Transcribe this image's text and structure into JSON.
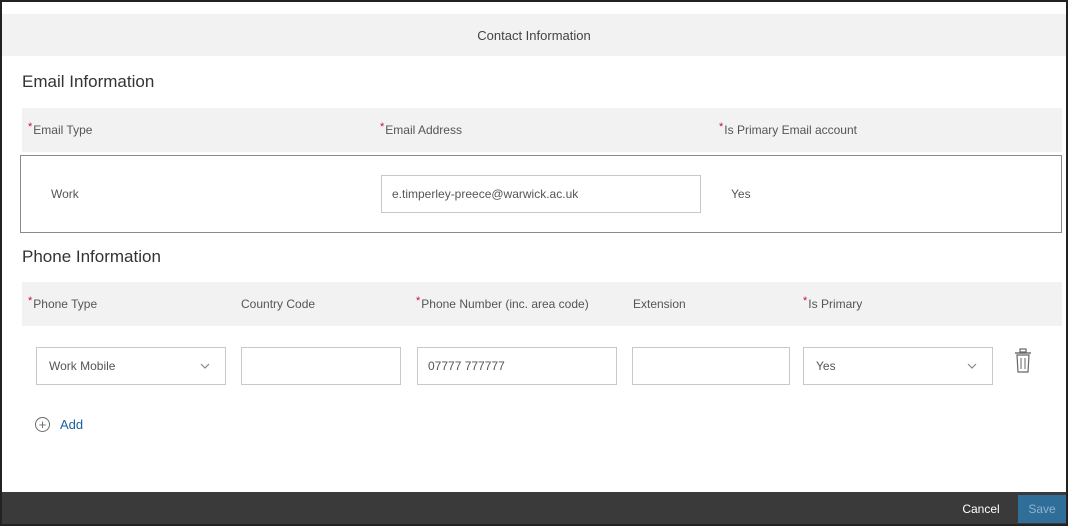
{
  "dialog": {
    "title": "Contact Information"
  },
  "email": {
    "section_title": "Email Information",
    "headers": {
      "type": "Email Type",
      "address": "Email Address",
      "primary": "Is Primary Email account"
    },
    "row": {
      "type": "Work",
      "address": "e.timperley-preece@warwick.ac.uk",
      "primary": "Yes"
    }
  },
  "phone": {
    "section_title": "Phone Information",
    "headers": {
      "type": "Phone Type",
      "country_code": "Country Code",
      "number": "Phone Number (inc. area code)",
      "extension": "Extension",
      "primary": "Is Primary"
    },
    "row": {
      "type": "Work Mobile",
      "country_code": "",
      "number": "07777 777777",
      "extension": "",
      "primary": "Yes"
    }
  },
  "actions": {
    "add_label": "Add",
    "cancel_label": "Cancel",
    "save_label": "Save"
  },
  "icons": {
    "dropdown": "chevron-down-icon",
    "delete": "trash-icon",
    "add": "plus-circle-icon"
  },
  "colors": {
    "required": "#c8102e",
    "link": "#1a5f9e",
    "footer": "#3a3a3a",
    "save_button": "#2f6e99"
  }
}
